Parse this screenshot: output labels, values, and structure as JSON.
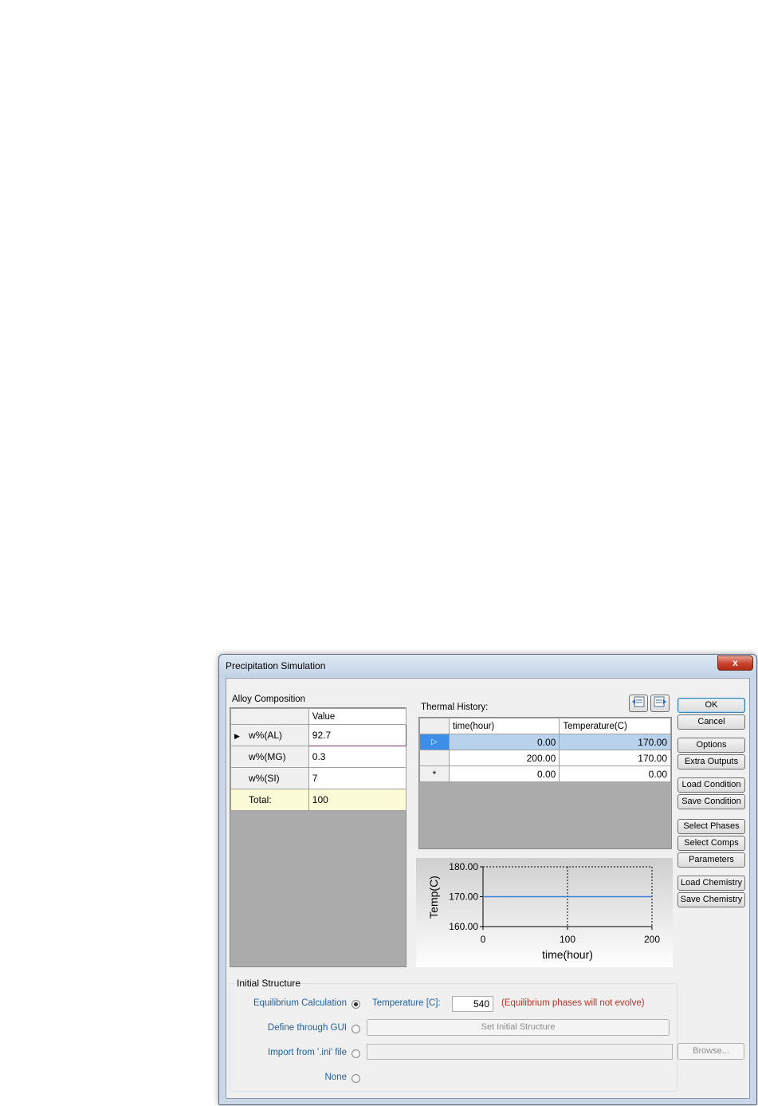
{
  "window": {
    "title": "Precipitation Simulation",
    "close_label": "x"
  },
  "alloy": {
    "title": "Alloy Composition",
    "header_value": "Value",
    "rows": [
      {
        "marker": "▶",
        "name": "w%(AL)",
        "value": "92.7"
      },
      {
        "marker": "",
        "name": "w%(MG)",
        "value": "0.3"
      },
      {
        "marker": "",
        "name": "w%(SI)",
        "value": "7"
      }
    ],
    "total_label": "Total:",
    "total_value": "100"
  },
  "thermal": {
    "title": "Thermal History:",
    "headers": [
      "time(hour)",
      "Temperature(C)"
    ],
    "rows": [
      {
        "marker": "▷",
        "time": "0.00",
        "temp": "170.00",
        "selected": true
      },
      {
        "marker": "",
        "time": "200.00",
        "temp": "170.00",
        "selected": false
      },
      {
        "marker": "*",
        "time": "0.00",
        "temp": "0.00",
        "selected": false
      }
    ],
    "insert_icon": "insert-row-icon",
    "delete_icon": "delete-row-icon"
  },
  "chart_data": {
    "type": "line",
    "xlabel": "time(hour)",
    "ylabel": "Temp(C)",
    "x_ticks": [
      "0",
      "100",
      "200"
    ],
    "y_ticks": [
      "180.00",
      "170.00",
      "160.00"
    ],
    "xlim": [
      0,
      200
    ],
    "ylim": [
      160,
      180
    ],
    "series": [
      {
        "x": [
          0,
          200
        ],
        "y": [
          170,
          170
        ],
        "color": "#3a7bd5"
      }
    ],
    "grid": "dashed"
  },
  "buttons": {
    "ok": "OK",
    "cancel": "Cancel",
    "options": "Options",
    "extra_outputs": "Extra Outputs",
    "load_condition": "Load Condition",
    "save_condition": "Save Condition",
    "select_phases": "Select Phases",
    "select_comps": "Select Comps",
    "parameters": "Parameters",
    "load_chemistry": "Load Chemistry",
    "save_chemistry": "Save Chemistry",
    "browse": "Browse..."
  },
  "initial": {
    "title": "Initial Structure",
    "equilibrium_label": "Equilibrium Calculation",
    "temperature_label": "Temperature [C]:",
    "temperature_value": "540",
    "note": "(Equilibrium phases will not evolve)",
    "gui_label": "Define through GUI",
    "set_structure": "Set Initial Structure",
    "import_label": "Import from '.ini' file",
    "none_label": "None"
  }
}
